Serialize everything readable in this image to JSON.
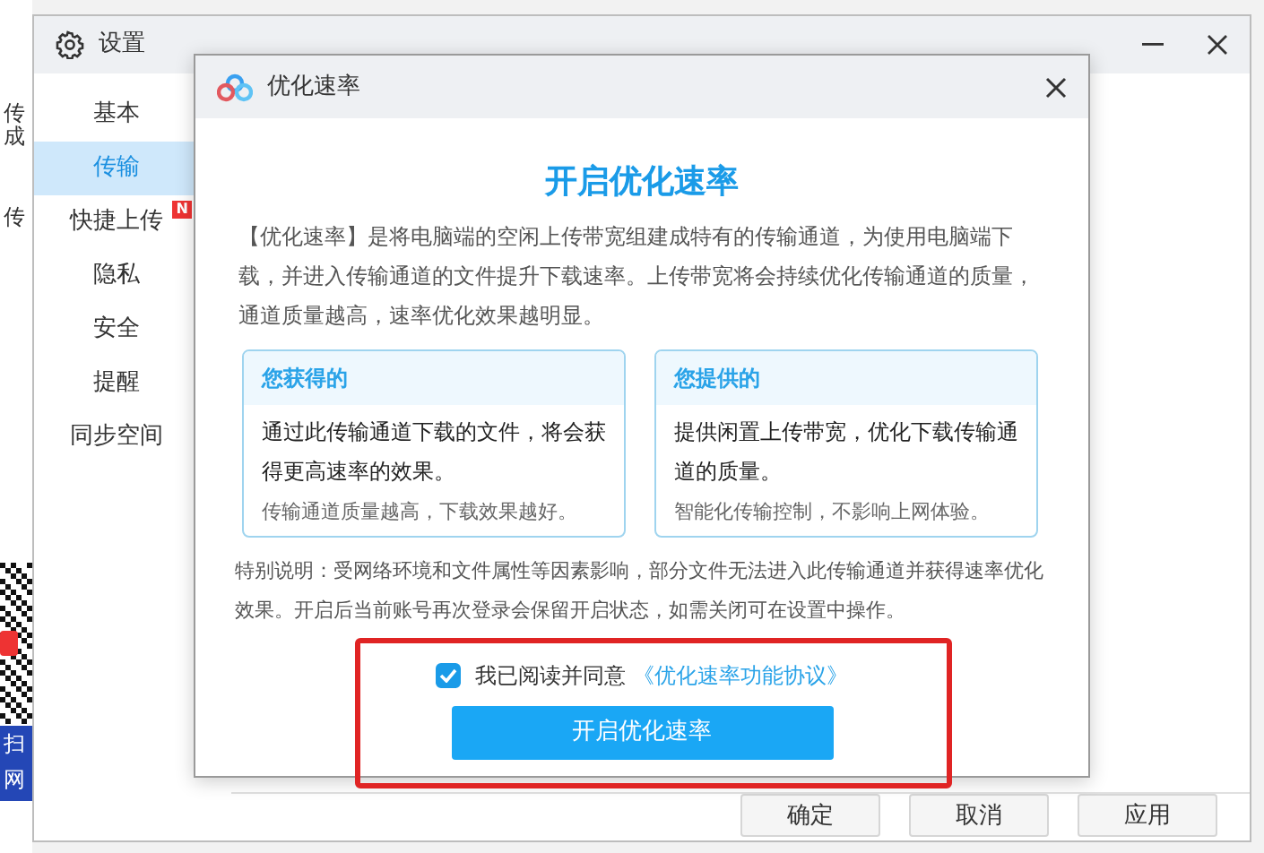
{
  "background_app": {
    "fragments": [
      "传",
      "成",
      "传"
    ],
    "banner_lines": [
      "扫",
      "网"
    ]
  },
  "settings_window": {
    "title": "设置",
    "sidebar": {
      "items": [
        {
          "label": "基本",
          "selected": false
        },
        {
          "label": "传输",
          "selected": true
        },
        {
          "label": "快捷上传",
          "selected": false,
          "badge": "N"
        },
        {
          "label": "隐私",
          "selected": false
        },
        {
          "label": "安全",
          "selected": false
        },
        {
          "label": "提醒",
          "selected": false
        },
        {
          "label": "同步空间",
          "selected": false
        }
      ]
    },
    "buttons": [
      "确定",
      "取消",
      "应用"
    ]
  },
  "dialog": {
    "title": "优化速率",
    "heading": "开启优化速率",
    "intro": "【优化速率】是将电脑端的空闲上传带宽组建成特有的传输通道，为使用电脑端下载，并进入传输通道的文件提升下载速率。上传带宽将会持续优化传输通道的质量，通道质量越高，速率优化效果越明显。",
    "cards": [
      {
        "title": "您获得的",
        "body": "通过此传输通道下载的文件，将会获得更高速率的效果。",
        "note": "传输通道质量越高，下载效果越好。"
      },
      {
        "title": "您提供的",
        "body": "提供闲置上传带宽，优化下载传输通道的质量。",
        "note": "智能化传输控制，不影响上网体验。"
      }
    ],
    "notice": "特别说明：受网络环境和文件属性等因素影响，部分文件无法进入此传输通道并获得速率优化效果。开启后当前账号再次登录会保留开启状态，如需关闭可在设置中操作。",
    "agreement": {
      "checked": true,
      "text": "我已阅读并同意",
      "link": "《优化速率功能协议》"
    },
    "primary_button": "开启优化速率"
  }
}
